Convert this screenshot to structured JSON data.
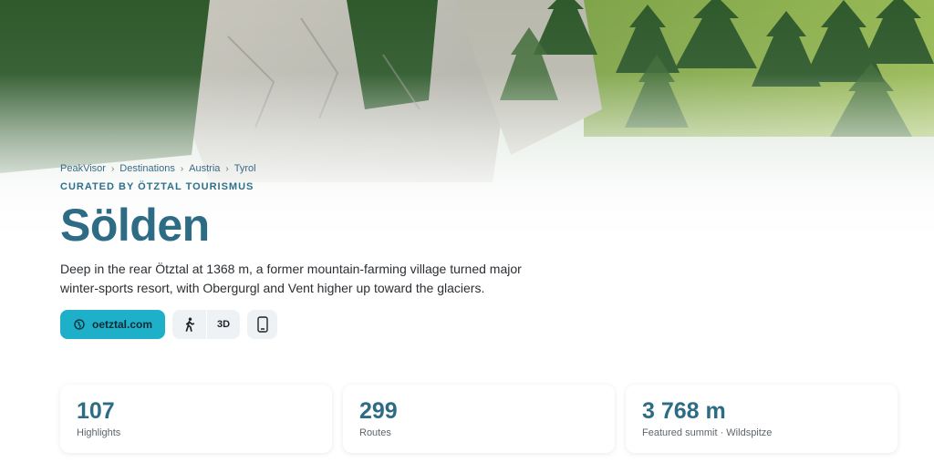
{
  "colors": {
    "accent": "#1fb0c9",
    "title": "#2e6c85",
    "link": "#3a6a84"
  },
  "breadcrumb": {
    "items": [
      "PeakVisor",
      "Destinations",
      "Austria",
      "Tyrol"
    ],
    "separator": "›"
  },
  "curated": "CURATED BY ÖTZTAL TOURISMUS",
  "title": "Sölden",
  "description": "Deep in the rear Ötztal at 1368 m, a former mountain-farming village turned major winter-sports resort, with Obergurgl and Vent higher up toward the glaciers.",
  "actions": {
    "website_label": "oetztal.com",
    "website_icon": "globe-icon",
    "hike_icon": "hiker-icon",
    "view3d_label": "3D",
    "phone_icon": "smartphone-icon"
  },
  "stats": [
    {
      "value": "107",
      "label": "Highlights"
    },
    {
      "value": "299",
      "label": "Routes"
    },
    {
      "value": "3 768 m",
      "label": "Featured summit · Wildspitze"
    }
  ]
}
